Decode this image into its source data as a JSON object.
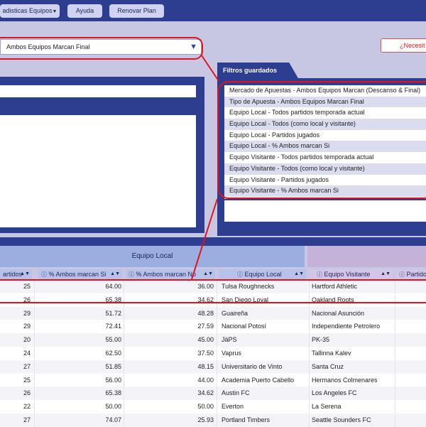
{
  "topbar": {
    "stats_menu": "adisticas Equipos",
    "help": "Ayuda",
    "renew": "Renovar Plan"
  },
  "market_select": {
    "value": "Ambos Equipos Marcan Final"
  },
  "need_button": "¿Necesit",
  "saved_filters": {
    "title": "Filtros guardados",
    "items": [
      "Mercado de Apuestas - Ambos Equipos Marcan (Descanso & Final)",
      "Tipo de Apuesta - Ambos Equipos Marcan Final",
      "Equipo Local - Todos partidos temporada actual",
      "Equipo Local - Todos (como local y visitante)",
      "Equipo Local - Partidos jugados",
      "Equipo Local - % Ambos marcan Si",
      "Equipo Visitante - Todos partidos temporada actual",
      "Equipo Visitante - Todos (como local y visitante)",
      "Equipo Visitante - Partidos jugados",
      "Equipo Visitante - % Ambos marcan Si"
    ]
  },
  "table": {
    "group_local": "Equipo Local",
    "headers": {
      "partidos": "artidos",
      "pct_si": "% Ambos marcan Si",
      "pct_no": "% Ambos marcan No",
      "local": "Equipo Local",
      "visitante": "Equipo Visitante",
      "partidos_v": "Partido"
    },
    "rows": [
      {
        "partidos": "25",
        "si": "64.00",
        "no": "36.00",
        "local": "Tulsa Roughnecks",
        "visitante": "Hartford Athletic"
      },
      {
        "partidos": "26",
        "si": "65.38",
        "no": "34.62",
        "local": "San Diego Loyal",
        "visitante": "Oakland Roots"
      },
      {
        "partidos": "29",
        "si": "51.72",
        "no": "48.28",
        "local": "Guaireña",
        "visitante": "Nacional Asunción"
      },
      {
        "partidos": "29",
        "si": "72.41",
        "no": "27.59",
        "local": "Nacional Potosí",
        "visitante": "Independiente Petrolero"
      },
      {
        "partidos": "20",
        "si": "55.00",
        "no": "45.00",
        "local": "JäPS",
        "visitante": "PK-35"
      },
      {
        "partidos": "24",
        "si": "62.50",
        "no": "37.50",
        "local": "Vaprus",
        "visitante": "Tallinna Kalev"
      },
      {
        "partidos": "27",
        "si": "51.85",
        "no": "48.15",
        "local": "Universitario de Vinto",
        "visitante": "Santa Cruz"
      },
      {
        "partidos": "25",
        "si": "56.00",
        "no": "44.00",
        "local": "Academia Puerto Cabello",
        "visitante": "Hermanos Colmenares"
      },
      {
        "partidos": "26",
        "si": "65.38",
        "no": "34.62",
        "local": "Austin FC",
        "visitante": "Los Angeles FC"
      },
      {
        "partidos": "22",
        "si": "50.00",
        "no": "50.00",
        "local": "Everton",
        "visitante": "La Serena"
      },
      {
        "partidos": "27",
        "si": "74.07",
        "no": "25.93",
        "local": "Portland Timbers",
        "visitante": "Seattle Sounders FC"
      }
    ]
  },
  "colors": {
    "navy": "#2d3d8f",
    "background": "#c7c7e4",
    "highlight_red": "#e0141e"
  },
  "icons": {
    "dropdown": "triangle-down-icon",
    "info": "info-circle-icon",
    "sort": "sort-arrows-icon"
  }
}
